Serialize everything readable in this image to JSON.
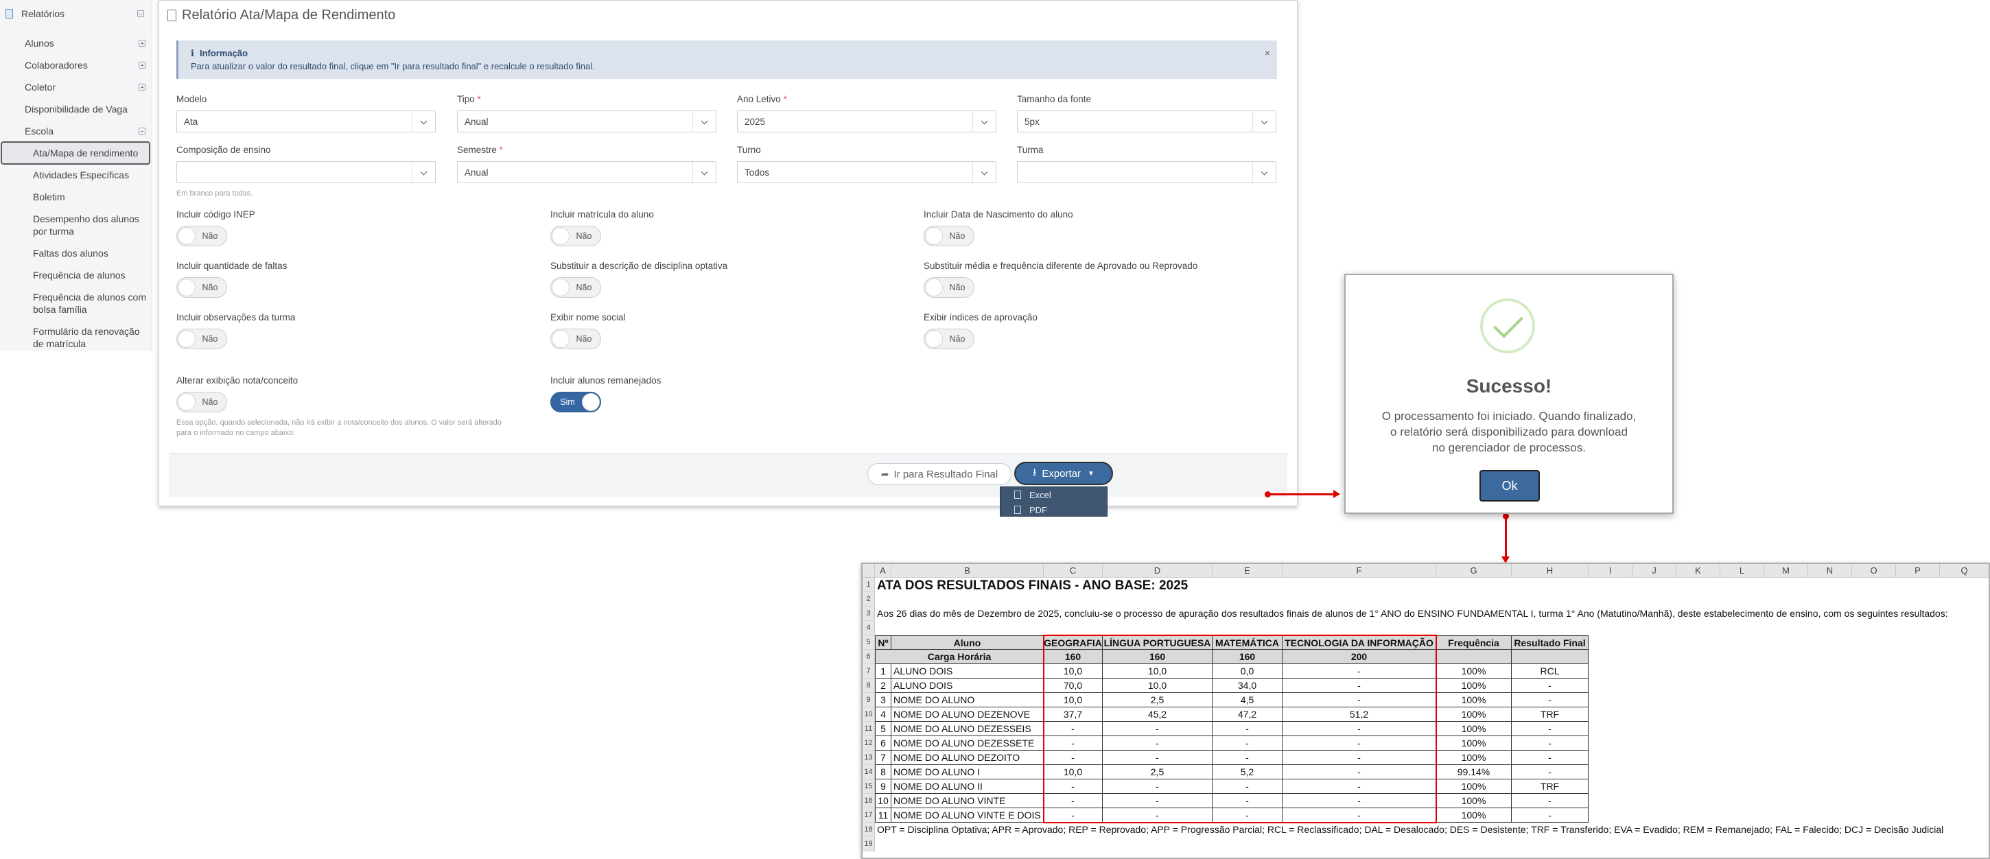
{
  "sidebar": {
    "root": "Relatórios",
    "items": [
      "Alunos",
      "Colaboradores",
      "Coletor",
      "Disponibilidade de Vaga",
      "Escola"
    ],
    "sub_items": [
      "Ata/Mapa de rendimento",
      "Atividades Específicas",
      "Boletim",
      "Desempenho dos alunos",
      "por turma",
      "Faltas dos alunos",
      "Frequência de alunos",
      "Frequência de alunos com",
      "bolsa família",
      "Formulário da renovação",
      "de matrícula"
    ]
  },
  "page": {
    "title": "Relatório Ata/Mapa de Rendimento",
    "info_title": "Informação",
    "info_text": "Para atualizar o valor do resultado final, clique em \"Ir para resultado final\" e recalcule o resultado final.",
    "close": "×"
  },
  "form": {
    "modelo_label": "Modelo",
    "modelo_value": "Ata",
    "tipo_label": "Tipo",
    "tipo_value": "Anual",
    "ano_label": "Ano Letivo",
    "ano_value": "2025",
    "fonte_label": "Tamanho da fonte",
    "fonte_value": "5px",
    "composicao_label": "Composição de ensino",
    "composicao_value": "",
    "semestre_label": "Semestre",
    "semestre_value": "Anual",
    "turno_label": "Turno",
    "turno_value": "Todos",
    "turma_label": "Turma",
    "turma_value": "",
    "required_mark": "*",
    "blank_hint": "Em branco para todas.",
    "nota_hint_1": "Essa opção, quando selecionada, não irá exibir a nota/conceito dos alunos. O valor será alterado",
    "nota_hint_2": "para o informado no campo abaixo:"
  },
  "toggles": {
    "inep": {
      "label": "Incluir código INEP",
      "value": "Não"
    },
    "matricula": {
      "label": "Incluir matrícula do aluno",
      "value": "Não"
    },
    "nascimento": {
      "label": "Incluir Data de Nascimento do aluno",
      "value": "Não"
    },
    "faltas": {
      "label": "Incluir quantidade de faltas",
      "value": "Não"
    },
    "optativa": {
      "label": "Substituir a descrição de disciplina optativa",
      "value": "Não"
    },
    "media": {
      "label": "Substituir média e frequência diferente de Aprovado ou Reprovado",
      "value": "Não"
    },
    "observacoes": {
      "label": "Incluir observações da turma",
      "value": "Não"
    },
    "social": {
      "label": "Exibir nome social",
      "value": "Não"
    },
    "indices": {
      "label": "Exibir índices de aprovação",
      "value": "Não"
    },
    "nota": {
      "label": "Alterar exibição nota/conceito",
      "value": "Não"
    },
    "remanejados": {
      "label": "Incluir alunos remanejados",
      "value": "Sim"
    }
  },
  "actions": {
    "result_button": "Ir para Resultado Final",
    "export_button": "Exportar",
    "menu": [
      "Excel",
      "PDF"
    ]
  },
  "dialog": {
    "title": "Sucesso!",
    "lines": [
      "O processamento foi iniciado. Quando finalizado,",
      "o relatório será disponibilizado para download",
      "no gerenciador de processos."
    ],
    "ok": "Ok"
  },
  "sheet": {
    "columns": [
      "A",
      "B",
      "C",
      "D",
      "E",
      "F",
      "G",
      "H",
      "I",
      "J",
      "K",
      "L",
      "M",
      "N",
      "O",
      "P",
      "Q"
    ],
    "rows": [
      "1",
      "2",
      "3",
      "4",
      "5",
      "6",
      "7",
      "8",
      "9",
      "10",
      "11",
      "12",
      "13",
      "14",
      "15",
      "16",
      "17",
      "18",
      "19"
    ],
    "title": "ATA DOS RESULTADOS FINAIS - ANO BASE: 2025",
    "intro": "Aos 26 dias do mês de Dezembro de 2025, concluiu-se o processo de apuração dos resultados finais de alunos de 1° ANO do ENSINO FUNDAMENTAL I, turma 1° Ano (Matutino/Manhã), deste estabelecimento de ensino, com os seguintes resultados:",
    "headers": [
      "Nº",
      "Aluno",
      "GEOGRAFIA",
      "LÍNGUA PORTUGUESA",
      "MATEMÁTICA",
      "TECNOLOGIA DA INFORMAÇÃO",
      "Frequência",
      "Resultado Final"
    ],
    "carga_label": "Carga Horária",
    "carga": [
      "160",
      "160",
      "160",
      "200"
    ],
    "students": [
      [
        "1",
        "ALUNO DOIS",
        "10,0",
        "10,0",
        "0,0",
        "-",
        "100%",
        "RCL"
      ],
      [
        "2",
        "ALUNO DOIS",
        "70,0",
        "10,0",
        "34,0",
        "-",
        "100%",
        "-"
      ],
      [
        "3",
        "NOME DO ALUNO",
        "10,0",
        "2,5",
        "4,5",
        "-",
        "100%",
        "-"
      ],
      [
        "4",
        "NOME DO ALUNO DEZENOVE",
        "37,7",
        "45,2",
        "47,2",
        "51,2",
        "100%",
        "TRF"
      ],
      [
        "5",
        "NOME DO ALUNO DEZESSEIS",
        "-",
        "-",
        "-",
        "-",
        "100%",
        "-"
      ],
      [
        "6",
        "NOME DO ALUNO DEZESSETE",
        "-",
        "-",
        "-",
        "-",
        "100%",
        "-"
      ],
      [
        "7",
        "NOME DO ALUNO DEZOITO",
        "-",
        "-",
        "-",
        "-",
        "100%",
        "-"
      ],
      [
        "8",
        "NOME DO ALUNO I",
        "10,0",
        "2,5",
        "5,2",
        "-",
        "99.14%",
        "-"
      ],
      [
        "9",
        "NOME DO ALUNO II",
        "-",
        "-",
        "-",
        "-",
        "100%",
        "TRF"
      ],
      [
        "10",
        "NOME DO ALUNO VINTE",
        "-",
        "-",
        "-",
        "-",
        "100%",
        "-"
      ],
      [
        "11",
        "NOME DO ALUNO VINTE E DOIS",
        "-",
        "-",
        "-",
        "-",
        "100%",
        "-"
      ]
    ],
    "legend": "OPT = Disciplina Optativa; APR = Aprovado; REP = Reprovado; APP = Progressão Parcial; RCL = Reclassificado; DAL = Desalocado; DES = Desistente; TRF = Transferido; EVA = Evadido; REM = Remanejado; FAL = Falecido; DCJ = Decisão Judicial"
  }
}
